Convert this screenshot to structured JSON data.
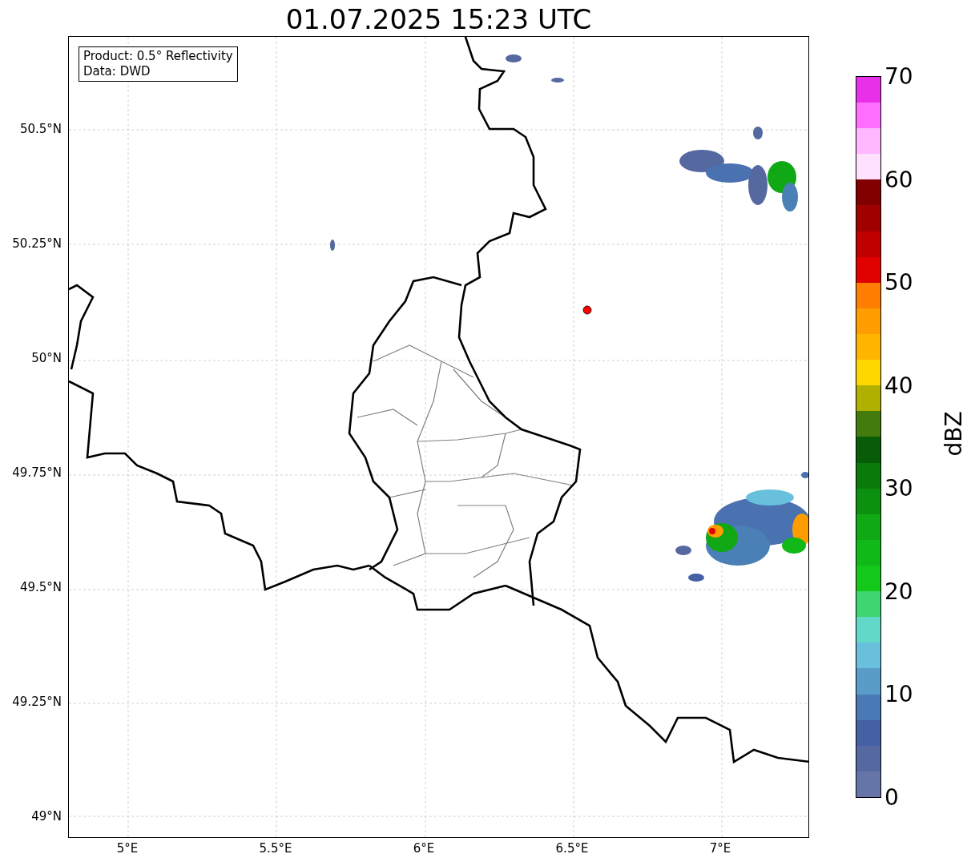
{
  "title": "01.07.2025 15:23 UTC",
  "info_box": {
    "lines": [
      "Product: 0.5° Reflectivity",
      "Data: DWD"
    ]
  },
  "lat_labels": [
    "50.5°N",
    "50.25°N",
    "50°N",
    "49.75°N",
    "49.5°N",
    "49.25°N",
    "49°N"
  ],
  "lon_labels": [
    "5°E",
    "5.5°E",
    "6°E",
    "6.5°E",
    "7°E"
  ],
  "colorbar": {
    "label": "dBZ",
    "ticks": [
      "70",
      "60",
      "50",
      "40",
      "30",
      "20",
      "10",
      "0"
    ],
    "bins": [
      {
        "color": "#6675a8"
      },
      {
        "color": "#5568a0"
      },
      {
        "color": "#4660a4"
      },
      {
        "color": "#4a7ab5"
      },
      {
        "color": "#5a9cc8"
      },
      {
        "color": "#68c0dc"
      },
      {
        "color": "#62d8c8"
      },
      {
        "color": "#3dd670"
      },
      {
        "color": "#14c81a"
      },
      {
        "color": "#10b818"
      },
      {
        "color": "#10a814"
      },
      {
        "color": "#0c9010"
      },
      {
        "color": "#0a7a0a"
      },
      {
        "color": "#085c08"
      },
      {
        "color": "#437a0c"
      },
      {
        "color": "#b0b000"
      },
      {
        "color": "#ffd700"
      },
      {
        "color": "#ffb400"
      },
      {
        "color": "#ff9c00"
      },
      {
        "color": "#ff7d00"
      },
      {
        "color": "#e00000"
      },
      {
        "color": "#c00000"
      },
      {
        "color": "#a00000"
      },
      {
        "color": "#800000"
      },
      {
        "color": "#ffe0ff"
      },
      {
        "color": "#ffb8ff"
      },
      {
        "color": "#ff6eff"
      },
      {
        "color": "#e830e8"
      }
    ]
  }
}
